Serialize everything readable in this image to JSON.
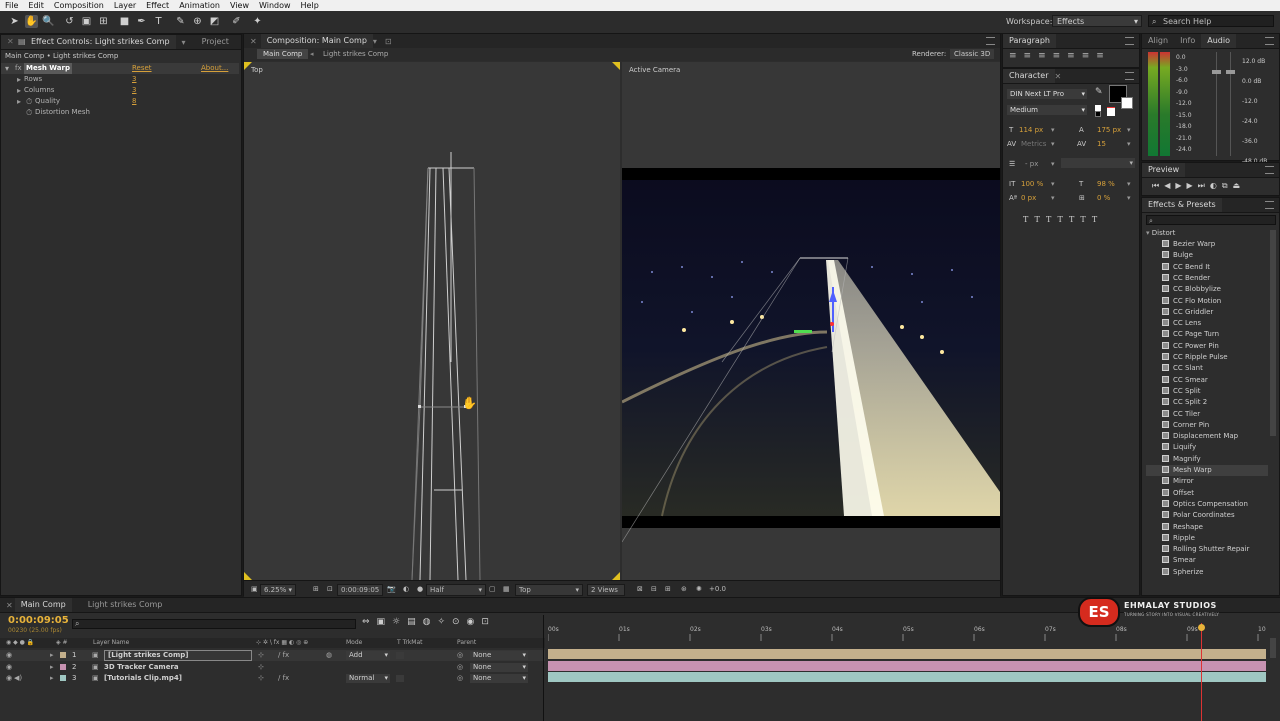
{
  "menu": [
    "File",
    "Edit",
    "Composition",
    "Layer",
    "Effect",
    "Animation",
    "View",
    "Window",
    "Help"
  ],
  "toolbar": {
    "workspace_label": "Workspace:",
    "workspace_value": "Effects",
    "search_placeholder": "Search Help"
  },
  "effect_controls": {
    "tab_label": "Effect Controls: Light strikes Comp",
    "project_tab": "Project",
    "breadcrumb": "Main Comp • Light strikes Comp",
    "effect_name": "Mesh Warp",
    "reset": "Reset",
    "about": "About...",
    "properties": [
      {
        "label": "Rows",
        "value": "3"
      },
      {
        "label": "Columns",
        "value": "3"
      },
      {
        "label": "Quality",
        "value": "8"
      },
      {
        "label": "Distortion Mesh",
        "value": ""
      }
    ]
  },
  "composition": {
    "tab_label": "Composition: Main Comp",
    "crumb_main": "Main Comp",
    "crumb_child": "Light strikes Comp",
    "renderer_label": "Renderer:",
    "renderer_value": "Classic 3D",
    "left_view_label": "Top",
    "right_view_label": "Active Camera",
    "footer": {
      "zoom": "6.25%",
      "timecode": "0:00:09:05",
      "resolution": "Half",
      "view": "Top",
      "views": "2 Views",
      "exposure": "+0.0"
    }
  },
  "paragraph": {
    "tab_label": "Paragraph"
  },
  "character": {
    "tab_label": "Character",
    "font": "DIN Next LT Pro",
    "style": "Medium",
    "size": "114 px",
    "leading": "175 px",
    "kerning": "Metrics",
    "tracking": "15",
    "stroke": "- px",
    "vscale": "100 %",
    "hscale": "98 %",
    "baseline": "0 px",
    "tsume": "0 %"
  },
  "audio": {
    "tabs": [
      "Align",
      "Info",
      "Audio"
    ],
    "left_scale": [
      "0.0",
      "-3.0",
      "-6.0",
      "-9.0",
      "-12.0",
      "-15.0",
      "-18.0",
      "-21.0",
      "-24.0"
    ],
    "right_scale": [
      "12.0 dB",
      "0.0 dB",
      "-12.0",
      "-24.0",
      "-36.0",
      "-48.0 dB"
    ]
  },
  "preview": {
    "tab_label": "Preview"
  },
  "effects_presets": {
    "tab_label": "Effects & Presets",
    "search_placeholder": "",
    "category": "Distort",
    "items": [
      "Bezier Warp",
      "Bulge",
      "CC Bend It",
      "CC Bender",
      "CC Blobbylize",
      "CC Flo Motion",
      "CC Griddler",
      "CC Lens",
      "CC Page Turn",
      "CC Power Pin",
      "CC Ripple Pulse",
      "CC Slant",
      "CC Smear",
      "CC Split",
      "CC Split 2",
      "CC Tiler",
      "Corner Pin",
      "Displacement Map",
      "Liquify",
      "Magnify",
      "Mesh Warp",
      "Mirror",
      "Offset",
      "Optics Compensation",
      "Polar Coordinates",
      "Reshape",
      "Ripple",
      "Rolling Shutter Repair",
      "Smear",
      "Spherize"
    ],
    "selected": "Mesh Warp"
  },
  "timeline": {
    "tabs": [
      "Main Comp",
      "Light strikes Comp"
    ],
    "timecode": "0:00:09:05",
    "frame_info": "00230 (25.00 fps)",
    "columns": {
      "layer_name": "Layer Name",
      "mode": "Mode",
      "trkmat": "T  TrkMat",
      "parent": "Parent"
    },
    "layers": [
      {
        "num": "1",
        "name": "[Light strikes Comp]",
        "mode": "Add",
        "parent": "None",
        "color": "#c4b08c"
      },
      {
        "num": "2",
        "name": "3D Tracker Camera",
        "mode": "",
        "parent": "None",
        "color": "#c792b1"
      },
      {
        "num": "3",
        "name": "[Tutorials Clip.mp4]",
        "mode": "Normal",
        "parent": "None",
        "color": "#9fc7c2"
      }
    ],
    "ruler": [
      "00s",
      "01s",
      "02s",
      "03s",
      "04s",
      "05s",
      "06s",
      "07s",
      "08s",
      "09s",
      "10s"
    ],
    "playhead_time": 9.2,
    "duration": 10
  },
  "watermark": {
    "logo_text": "ES",
    "title": "EHMALAY STUDIOS",
    "subtitle": "TURNING STORY INTO VISUAL CREATIVELY"
  },
  "colors": {
    "accent": "#d6a03a",
    "panel": "#2d2d2d",
    "viewer": "#373737"
  }
}
